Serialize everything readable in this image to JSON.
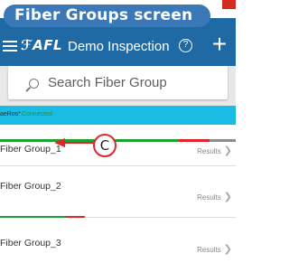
{
  "callout": {
    "title": "Fiber Groups screen",
    "badge": "C"
  },
  "header": {
    "brand": "AFL",
    "brand_symbol": "ℱ",
    "title": "Demo Inspection",
    "help_glyph": "?",
    "add_glyph": "+"
  },
  "search": {
    "placeholder": "Search Fiber Group",
    "value": ""
  },
  "status": {
    "label": "aeRos*",
    "sub": "Connected"
  },
  "groups": [
    {
      "name": "Fiber Group_1",
      "results": "Results",
      "progress": {
        "pass": 0.76,
        "fail": 0.13,
        "pending": 0.11
      }
    },
    {
      "name": "Fiber Group_2",
      "results": "Results",
      "progress": {
        "pass": 0.28,
        "fail": 0.08,
        "pending": 0.0
      }
    },
    {
      "name": "Fiber Group_3",
      "results": "Results",
      "progress": {
        "pass": 0.0,
        "fail": 0.0,
        "pending": 0.0
      }
    }
  ],
  "colors": {
    "header": "#1f6aa5",
    "callout": "#3a78b8",
    "status_bar": "#19bde3",
    "pass": "#1fa034",
    "fail": "#e3242b",
    "pending": "#8c8c8c",
    "badge_border": "#e0262b"
  },
  "icons": {
    "menu": "menu-icon",
    "help": "help-icon",
    "add": "add-icon",
    "search": "search-icon",
    "chevron": "chevron-right-icon"
  }
}
